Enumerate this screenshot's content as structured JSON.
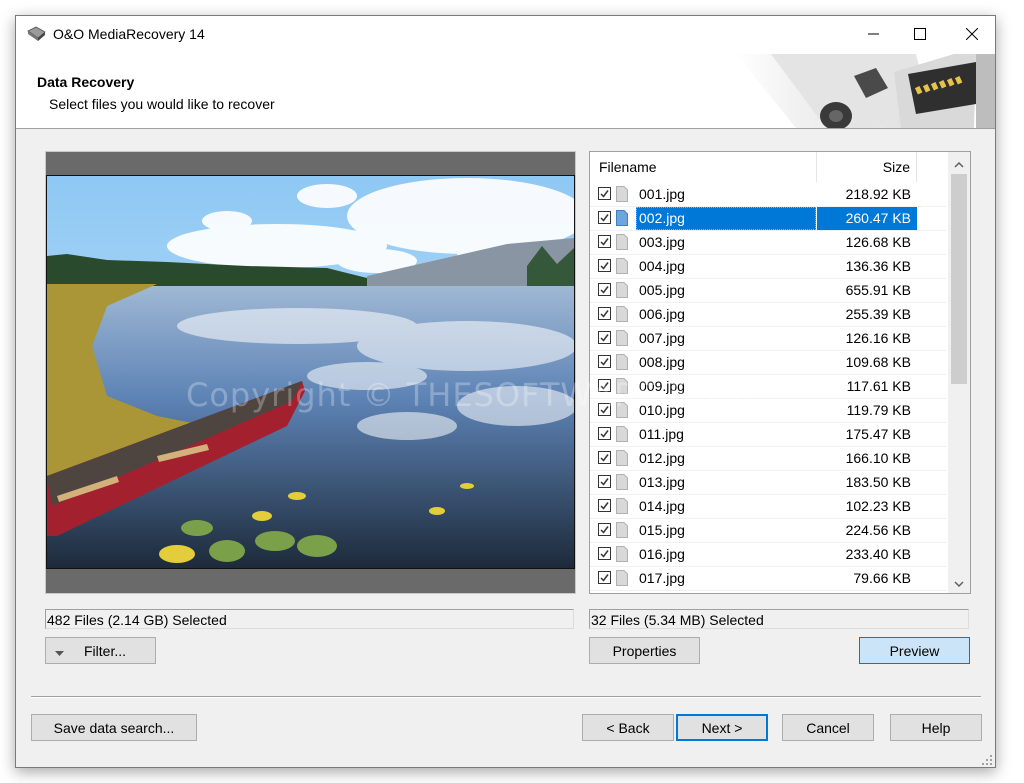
{
  "window": {
    "title": "O&O MediaRecovery 14",
    "app_icon": "disk-recovery-icon",
    "controls": [
      "minimize-icon",
      "maximize-icon",
      "close-icon"
    ]
  },
  "header": {
    "title": "Data Recovery",
    "subtitle": "Select files you would like to recover"
  },
  "preview": {
    "watermark": "Copyright © THESOFTWARE.SHOP",
    "status": "482 Files (2.14 GB) Selected",
    "filter_label": "Filter..."
  },
  "file_list": {
    "columns": {
      "filename": "Filename",
      "size": "Size"
    },
    "rows": [
      {
        "name": "001.jpg",
        "size": "218.92 KB",
        "checked": true,
        "selected": false
      },
      {
        "name": "002.jpg",
        "size": "260.47 KB",
        "checked": true,
        "selected": true
      },
      {
        "name": "003.jpg",
        "size": "126.68 KB",
        "checked": true,
        "selected": false
      },
      {
        "name": "004.jpg",
        "size": "136.36 KB",
        "checked": true,
        "selected": false
      },
      {
        "name": "005.jpg",
        "size": "655.91 KB",
        "checked": true,
        "selected": false
      },
      {
        "name": "006.jpg",
        "size": "255.39 KB",
        "checked": true,
        "selected": false
      },
      {
        "name": "007.jpg",
        "size": "126.16 KB",
        "checked": true,
        "selected": false
      },
      {
        "name": "008.jpg",
        "size": "109.68 KB",
        "checked": true,
        "selected": false
      },
      {
        "name": "009.jpg",
        "size": "117.61 KB",
        "checked": true,
        "selected": false
      },
      {
        "name": "010.jpg",
        "size": "119.79 KB",
        "checked": true,
        "selected": false
      },
      {
        "name": "011.jpg",
        "size": "175.47 KB",
        "checked": true,
        "selected": false
      },
      {
        "name": "012.jpg",
        "size": "166.10 KB",
        "checked": true,
        "selected": false
      },
      {
        "name": "013.jpg",
        "size": "183.50 KB",
        "checked": true,
        "selected": false
      },
      {
        "name": "014.jpg",
        "size": "102.23 KB",
        "checked": true,
        "selected": false
      },
      {
        "name": "015.jpg",
        "size": "224.56 KB",
        "checked": true,
        "selected": false
      },
      {
        "name": "016.jpg",
        "size": "233.40 KB",
        "checked": true,
        "selected": false
      },
      {
        "name": "017.jpg",
        "size": "79.66 KB",
        "checked": true,
        "selected": false
      }
    ],
    "status": "32 Files (5.34 MB) Selected",
    "properties_label": "Properties",
    "preview_label": "Preview"
  },
  "footer": {
    "save_label": "Save data search...",
    "back_label": "< Back",
    "next_label": "Next >",
    "cancel_label": "Cancel",
    "help_label": "Help"
  },
  "colors": {
    "selection": "#0078d7",
    "accent_button_bg": "#cce4f7",
    "preview_frame": "#6a6a6a"
  }
}
